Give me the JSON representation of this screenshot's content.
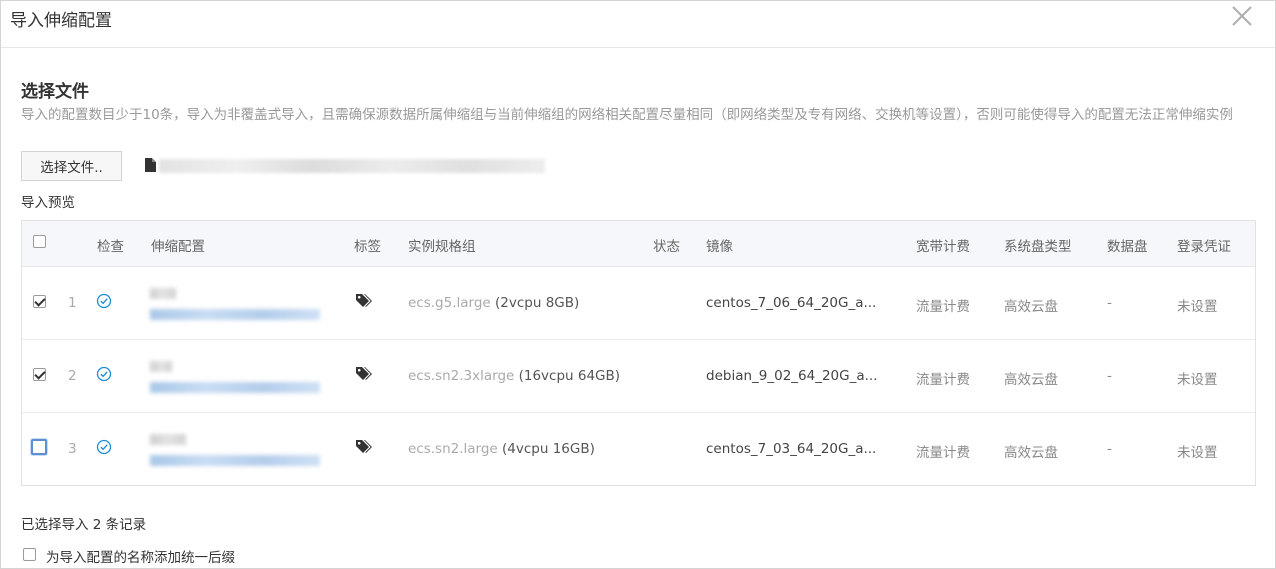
{
  "dialog": {
    "title": "导入伸缩配置",
    "close_icon": "close-icon"
  },
  "section": {
    "title": "选择文件",
    "notice": "导入的配置数目少于10条，导入为非覆盖式导入，且需确保源数据所属伸缩组与当前伸缩组的网络相关配置尽量相同（即网络类型及专有网络、交换机等设置），否则可能使得导入的配置无法正常伸缩实例",
    "choose_button": "选择文件..",
    "file_icon": "file-icon",
    "file_name": "",
    "preview_label": "导入预览"
  },
  "table": {
    "headers": {
      "check": "检查",
      "config": "伸缩配置",
      "tag": "标签",
      "spec": "实例规格组",
      "status": "状态",
      "image": "镜像",
      "bandwidth": "宽带计费",
      "disk_type": "系统盘类型",
      "data_disk": "数据盘",
      "login": "登录凭证"
    },
    "rows": [
      {
        "checked": true,
        "index": "1",
        "check_icon": "check-circle-icon",
        "tag_icon": "tag-icon",
        "spec_type": "ecs.g5.large",
        "spec_detail": "(2vcpu 8GB)",
        "status": "",
        "image": "centos_7_06_64_20G_a...",
        "bandwidth": "流量计费",
        "disk_type": "高效云盘",
        "data_disk": "-",
        "login": "未设置"
      },
      {
        "checked": true,
        "index": "2",
        "check_icon": "check-circle-icon",
        "tag_icon": "tag-icon",
        "spec_type": "ecs.sn2.3xlarge",
        "spec_detail": "(16vcpu 64GB)",
        "status": "",
        "image": "debian_9_02_64_20G_a...",
        "bandwidth": "流量计费",
        "disk_type": "高效云盘",
        "data_disk": "-",
        "login": "未设置"
      },
      {
        "checked": false,
        "index": "3",
        "check_icon": "check-circle-icon",
        "tag_icon": "tag-icon",
        "spec_type": "ecs.sn2.large",
        "spec_detail": "(4vcpu 16GB)",
        "status": "",
        "image": "centos_7_03_64_20G_a...",
        "bandwidth": "流量计费",
        "disk_type": "高效云盘",
        "data_disk": "-",
        "login": "未设置"
      }
    ]
  },
  "footer": {
    "summary": "已选择导入 2 条记录",
    "suffix_label": "为导入配置的名称添加统一后缀",
    "suffix_checked": false
  },
  "colors": {
    "accent": "#1a8fd6",
    "border": "#d4d4d4",
    "header_bg": "#f5f7fa"
  }
}
